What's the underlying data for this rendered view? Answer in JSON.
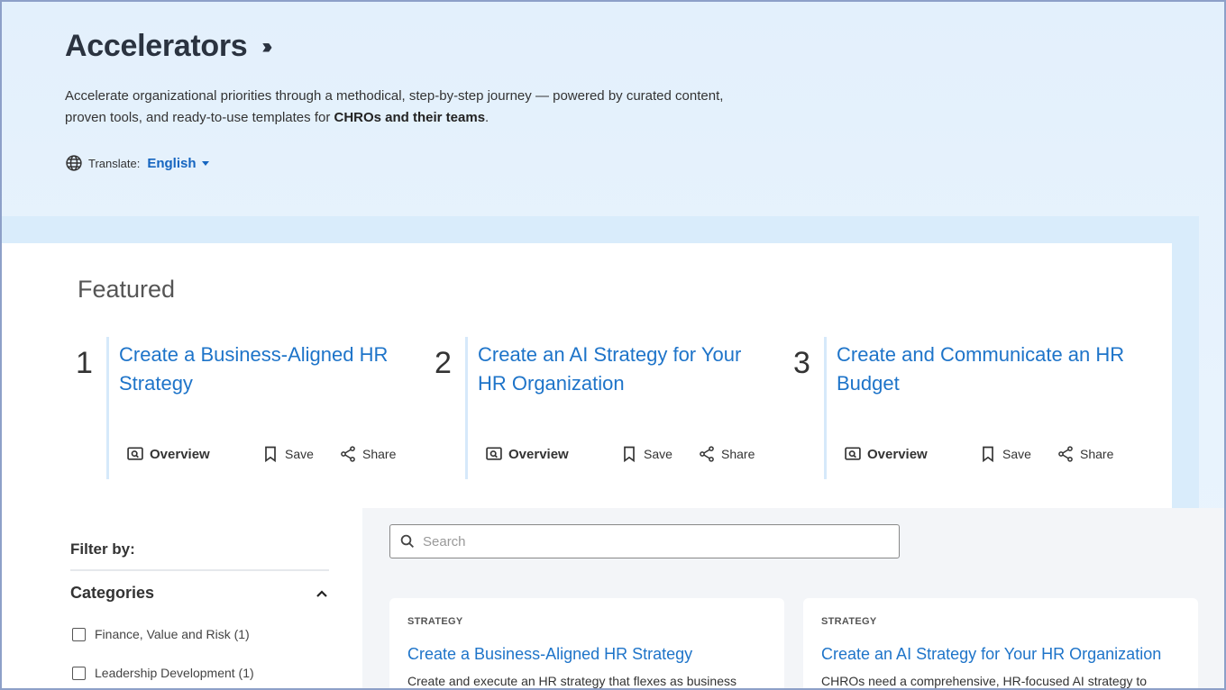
{
  "hero": {
    "title": "Accelerators",
    "chevrons": "›››",
    "description_part1": "Accelerate organizational priorities through a methodical, step-by-step journey — powered by curated content, proven tools, and ready-to-use templates for ",
    "description_bold": "CHROs and their teams",
    "description_end": ".",
    "translate_label": "Translate:",
    "language": "English"
  },
  "featured": {
    "title": "Featured",
    "items": [
      {
        "number": "1",
        "title": "Create a Business-Aligned HR Strategy"
      },
      {
        "number": "2",
        "title": "Create an AI Strategy for Your HR Organization"
      },
      {
        "number": "3",
        "title": "Create and Communicate an HR Budget"
      }
    ],
    "actions": {
      "overview": "Overview",
      "save": "Save",
      "share": "Share"
    }
  },
  "filters": {
    "title": "Filter by:",
    "categories_title": "Categories",
    "options": [
      "Finance, Value and Risk (1)",
      "Leadership Development (1)"
    ]
  },
  "search": {
    "placeholder": "Search",
    "value": ""
  },
  "results": [
    {
      "tag": "STRATEGY",
      "title": "Create a Business-Aligned HR Strategy",
      "description": "Create and execute an HR strategy that flexes as business"
    },
    {
      "tag": "STRATEGY",
      "title": "Create an AI Strategy for Your HR Organization",
      "description": "CHROs need a comprehensive, HR-focused AI strategy to"
    }
  ],
  "colors": {
    "accent": "#1e74c9",
    "hero_bg": "#e3f0fc",
    "featured_border": "#d6e9fa"
  }
}
